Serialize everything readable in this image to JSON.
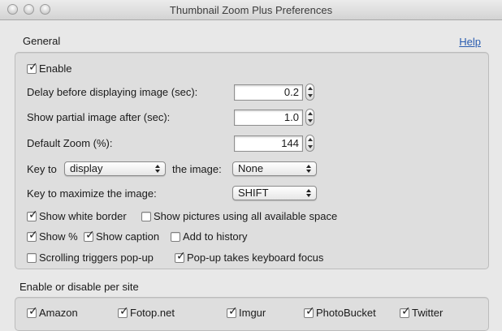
{
  "window": {
    "title": "Thumbnail Zoom Plus Preferences"
  },
  "general": {
    "title": "General",
    "help": "Help",
    "enable": {
      "label": "Enable",
      "checked": true
    },
    "delay": {
      "label": "Delay before displaying image (sec):",
      "value": "0.2"
    },
    "partial": {
      "label": "Show partial image after (sec):",
      "value": "1.0"
    },
    "zoom": {
      "label": "Default Zoom (%):",
      "value": "144"
    },
    "key_to": {
      "label": "Key to",
      "value": "display",
      "mid_label": "the image:",
      "modifier": "None"
    },
    "maximize": {
      "label": "Key to maximize the image:",
      "value": "SHIFT"
    },
    "options": {
      "white_border": {
        "label": "Show white border",
        "checked": true
      },
      "all_space": {
        "label": "Show pictures using all available space",
        "checked": false
      },
      "show_percent": {
        "label": "Show %",
        "checked": true
      },
      "show_caption": {
        "label": "Show caption",
        "checked": true
      },
      "add_history": {
        "label": "Add to history",
        "checked": false
      },
      "scrolling": {
        "label": "Scrolling triggers pop-up",
        "checked": false
      },
      "keyboard_focus": {
        "label": "Pop-up takes keyboard focus",
        "checked": true
      }
    }
  },
  "sites": {
    "title": "Enable or disable per site",
    "items": [
      {
        "label": "Amazon",
        "checked": true
      },
      {
        "label": "Fotop.net",
        "checked": true
      },
      {
        "label": "Imgur",
        "checked": true
      },
      {
        "label": "PhotoBucket",
        "checked": true
      },
      {
        "label": "Twitter",
        "checked": true
      }
    ]
  }
}
